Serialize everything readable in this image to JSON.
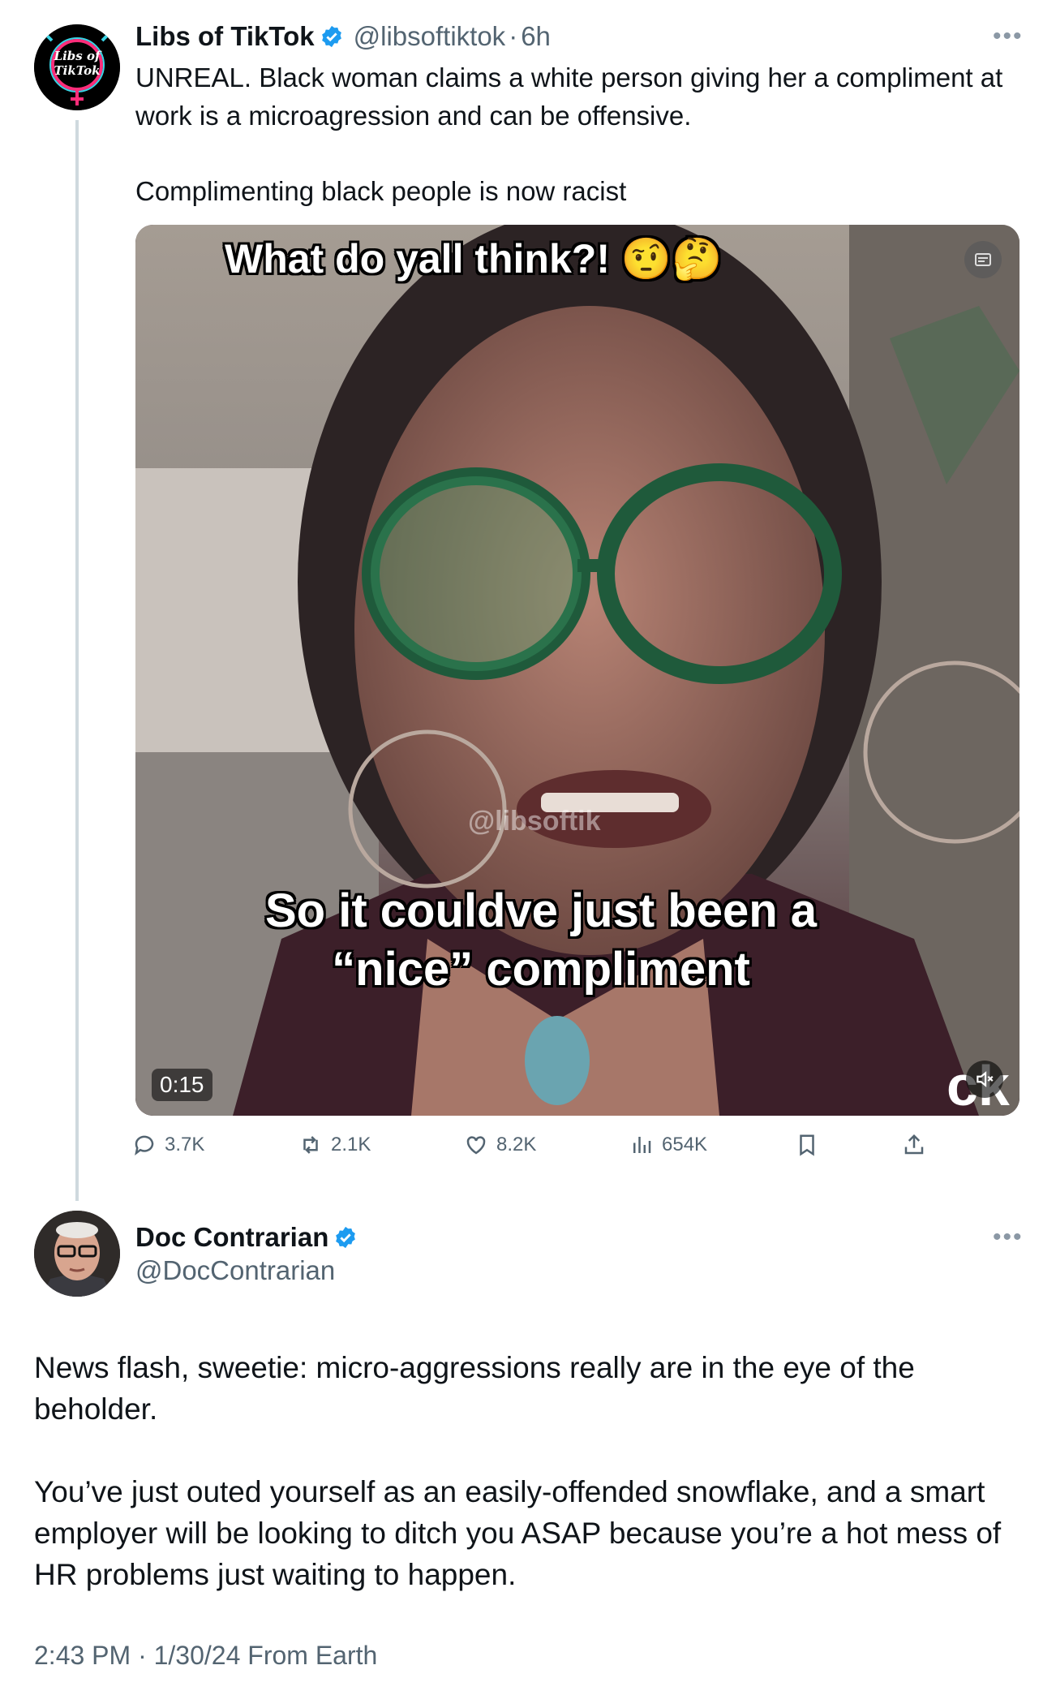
{
  "post": {
    "author_name": "Libs of TikTok",
    "handle": "@libsoftiktok",
    "separator": "·",
    "time": "6h",
    "avatar_text_line1": "Libs of",
    "avatar_text_line2": "TikTok",
    "text_para1": "UNREAL. Black woman claims a white person giving her a compliment at work is a microagression and can be offensive.",
    "text_para2": "Complimenting black people is now racist",
    "video": {
      "caption_top": "What do yall think?! 🤨🤔",
      "caption_bottom_line1": "So it couldve just been a",
      "caption_bottom_line2": "“nice” compliment",
      "watermark": "@libsoftik",
      "duration": "0:15"
    },
    "stats": {
      "replies": "3.7K",
      "reposts": "2.1K",
      "likes": "8.2K",
      "views": "654K"
    }
  },
  "reply": {
    "author_name": "Doc Contrarian",
    "handle": "@DocContrarian",
    "text_para1": "News flash, sweetie: micro-aggressions really are in the eye of the beholder.",
    "text_para2": "You’ve just outed yourself as an easily-offended snowflake, and a smart employer will be looking to ditch you ASAP because you’re a hot mess of HR problems just waiting to happen.",
    "timestamp": "2:43 PM · 1/30/24 From Earth"
  },
  "colors": {
    "verified": "#1d9bf0",
    "muted_text": "#536471",
    "thread_line": "#cfd9de"
  },
  "icons": [
    "verified-badge-icon",
    "more-icon",
    "reply-icon",
    "repost-icon",
    "like-icon",
    "views-icon",
    "bookmark-icon",
    "share-icon",
    "mute-icon",
    "alt-badge-icon"
  ]
}
